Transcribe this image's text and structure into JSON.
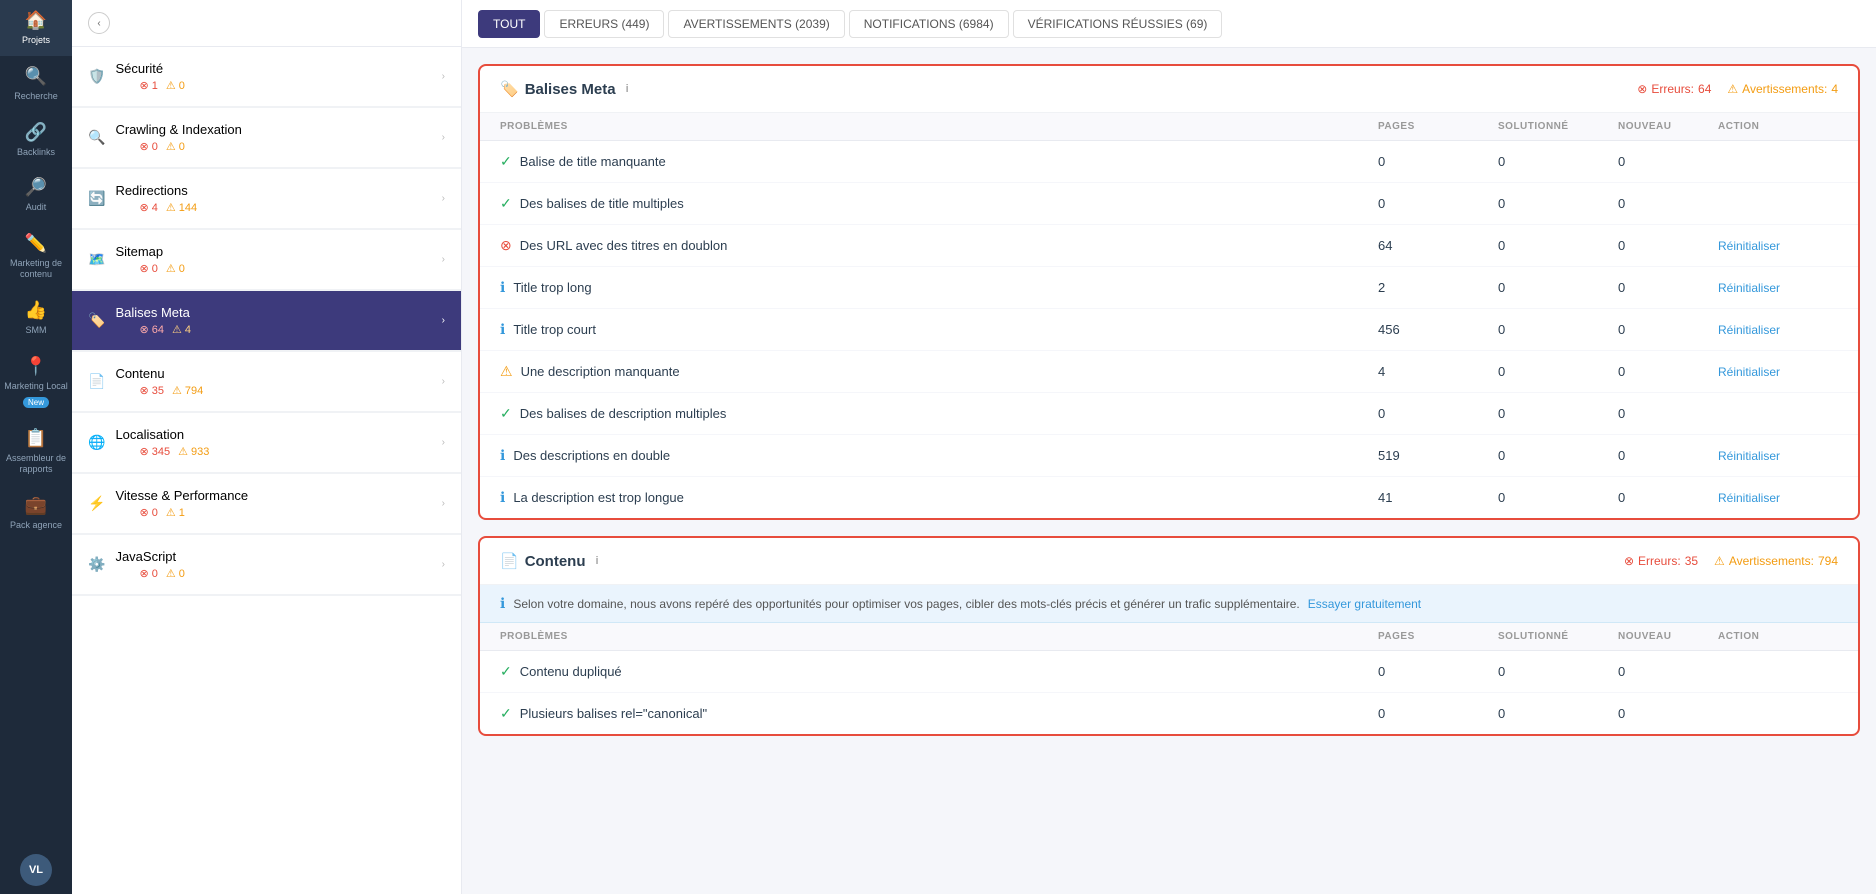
{
  "sidebar": {
    "items": [
      {
        "label": "Projets",
        "icon": "🏠",
        "active": true
      },
      {
        "label": "Recherche",
        "icon": "🔍",
        "active": false
      },
      {
        "label": "Backlinks",
        "icon": "🔗",
        "active": false
      },
      {
        "label": "Audit",
        "icon": "🔎",
        "active": false
      },
      {
        "label": "Marketing de contenu",
        "icon": "✏️",
        "active": false
      },
      {
        "label": "SMM",
        "icon": "👍",
        "active": false
      },
      {
        "label": "Marketing Local",
        "icon": "📍",
        "active": false
      },
      {
        "label": "Assembleur de rapports",
        "icon": "📋",
        "active": false
      },
      {
        "label": "Pack agence",
        "icon": "💼",
        "active": false
      }
    ],
    "badge_new": "New",
    "avatar": "VL"
  },
  "tabs": [
    {
      "label": "TOUT",
      "active": true
    },
    {
      "label": "ERREURS (449)",
      "active": false
    },
    {
      "label": "AVERTISSEMENTS (2039)",
      "active": false
    },
    {
      "label": "NOTIFICATIONS (6984)",
      "active": false
    },
    {
      "label": "VÉRIFICATIONS RÉUSSIES (69)",
      "active": false
    }
  ],
  "left_nav": {
    "items": [
      {
        "icon": "🛡️",
        "label": "Sécurité",
        "errors": 1,
        "warnings": 0,
        "active": false
      },
      {
        "icon": "🔍",
        "label": "Crawling & Indexation",
        "errors": 0,
        "warnings": 0,
        "active": false
      },
      {
        "icon": "🔄",
        "label": "Redirections",
        "errors": 4,
        "warnings": 144,
        "active": false
      },
      {
        "icon": "🗺️",
        "label": "Sitemap",
        "errors": 0,
        "warnings": 0,
        "active": false
      },
      {
        "icon": "🏷️",
        "label": "Balises Meta",
        "errors": 64,
        "warnings": 4,
        "active": true
      },
      {
        "icon": "📄",
        "label": "Contenu",
        "errors": 35,
        "warnings": 794,
        "active": false
      },
      {
        "icon": "🌐",
        "label": "Localisation",
        "errors": 345,
        "warnings": 933,
        "active": false
      },
      {
        "icon": "⚡",
        "label": "Vitesse & Performance",
        "errors": 0,
        "warnings": 1,
        "active": false
      },
      {
        "icon": "⚙️",
        "label": "JavaScript",
        "errors": 0,
        "warnings": 0,
        "active": false
      }
    ]
  },
  "balises_meta": {
    "section_title": "Balises Meta",
    "info_char": "i",
    "errors_label": "Erreurs:",
    "errors_count": "64",
    "warnings_label": "Avertissements:",
    "warnings_count": "4",
    "columns": {
      "problemes": "PROBLÈMES",
      "pages": "PAGES",
      "solutionne": "SOLUTIONNÉ",
      "nouveau": "NOUVEAU",
      "action": "ACTION"
    },
    "rows": [
      {
        "icon_type": "ok",
        "label": "Balise de title manquante",
        "pages": "0",
        "solutionne": "0",
        "nouveau": "0",
        "action": ""
      },
      {
        "icon_type": "ok",
        "label": "Des balises de title multiples",
        "pages": "0",
        "solutionne": "0",
        "nouveau": "0",
        "action": ""
      },
      {
        "icon_type": "error",
        "label": "Des URL avec des titres en doublon",
        "pages": "64",
        "solutionne": "0",
        "nouveau": "0",
        "action": "Réinitialiser"
      },
      {
        "icon_type": "info",
        "label": "Title trop long",
        "pages": "2",
        "solutionne": "0",
        "nouveau": "0",
        "action": "Réinitialiser"
      },
      {
        "icon_type": "info",
        "label": "Title trop court",
        "pages": "456",
        "solutionne": "0",
        "nouveau": "0",
        "action": "Réinitialiser"
      },
      {
        "icon_type": "warn",
        "label": "Une description manquante",
        "pages": "4",
        "solutionne": "0",
        "nouveau": "0",
        "action": "Réinitialiser"
      },
      {
        "icon_type": "ok",
        "label": "Des balises de description multiples",
        "pages": "0",
        "solutionne": "0",
        "nouveau": "0",
        "action": ""
      },
      {
        "icon_type": "info",
        "label": "Des descriptions en double",
        "pages": "519",
        "solutionne": "0",
        "nouveau": "0",
        "action": "Réinitialiser"
      },
      {
        "icon_type": "info",
        "label": "La description est trop longue",
        "pages": "41",
        "solutionne": "0",
        "nouveau": "0",
        "action": "Réinitialiser"
      }
    ]
  },
  "contenu": {
    "section_title": "Contenu",
    "info_char": "i",
    "errors_label": "Erreurs:",
    "errors_count": "35",
    "warnings_label": "Avertissements:",
    "warnings_count": "794",
    "info_bar_text": "Selon votre domaine, nous avons repéré des opportunités pour optimiser vos pages, cibler des mots-clés précis et générer un trafic supplémentaire.",
    "info_bar_link": "Essayer gratuitement",
    "columns": {
      "problemes": "PROBLÈMES",
      "pages": "PAGES",
      "solutionne": "SOLUTIONNÉ",
      "nouveau": "NOUVEAU",
      "action": "ACTION"
    },
    "rows": [
      {
        "icon_type": "ok",
        "label": "Contenu dupliqué",
        "pages": "0",
        "solutionne": "0",
        "nouveau": "0",
        "action": ""
      },
      {
        "icon_type": "ok",
        "label": "Plusieurs balises rel=\"canonical\"",
        "pages": "0",
        "solutionne": "0",
        "nouveau": "0",
        "action": ""
      }
    ]
  }
}
